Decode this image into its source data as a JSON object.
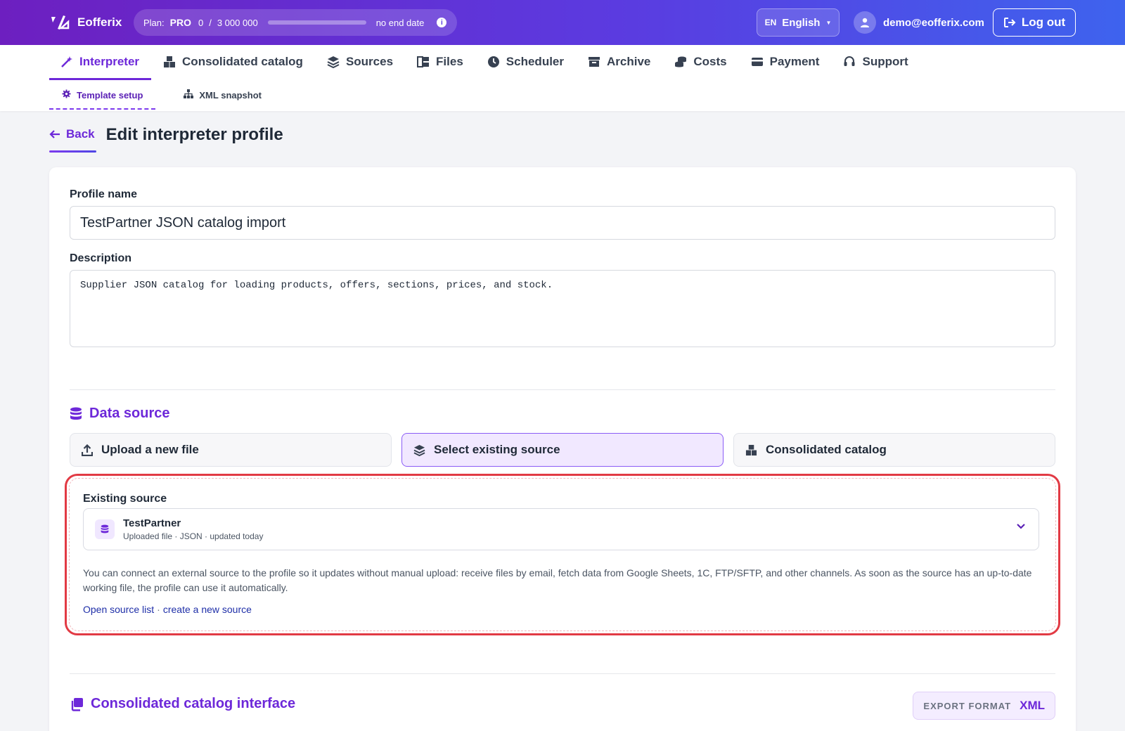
{
  "app": {
    "name": "Eofferix"
  },
  "plan": {
    "label": "Plan:",
    "name": "PRO",
    "used": "0",
    "separator": "/",
    "limit": "3 000 000",
    "usage_fraction": 0,
    "end_date": "no end date",
    "info_icon": "info-icon"
  },
  "language": {
    "code": "EN",
    "name": "English"
  },
  "user": {
    "email": "demo@eofferix.com"
  },
  "logout_label": "Log out",
  "nav": {
    "tabs": [
      {
        "label": "Interpreter",
        "icon": "magic-wand-icon",
        "active": true
      },
      {
        "label": "Consolidated catalog",
        "icon": "boxes-icon"
      },
      {
        "label": "Sources",
        "icon": "layers-icon"
      },
      {
        "label": "Files",
        "icon": "files-icon"
      },
      {
        "label": "Scheduler",
        "icon": "clock-icon"
      },
      {
        "label": "Archive",
        "icon": "archive-icon"
      },
      {
        "label": "Costs",
        "icon": "coins-icon"
      },
      {
        "label": "Payment",
        "icon": "credit-card-icon"
      },
      {
        "label": "Support",
        "icon": "headset-icon"
      }
    ],
    "subtabs": [
      {
        "label": "Template setup",
        "icon": "gear-icon",
        "active": true
      },
      {
        "label": "XML snapshot",
        "icon": "sitemap-icon"
      }
    ]
  },
  "page": {
    "back_label": "Back",
    "title": "Edit interpreter profile"
  },
  "form": {
    "profile_name_label": "Profile name",
    "profile_name_value": "TestPartner JSON catalog import",
    "description_label": "Description",
    "description_value": "Supplier JSON catalog for loading products, offers, sections, prices, and stock."
  },
  "data_source": {
    "title": "Data source",
    "options": [
      {
        "label": "Upload a new file",
        "icon": "upload-icon"
      },
      {
        "label": "Select existing source",
        "icon": "layers-icon",
        "active": true
      },
      {
        "label": "Consolidated catalog",
        "icon": "boxes-icon"
      }
    ],
    "existing_label": "Existing source",
    "selected": {
      "name": "TestPartner",
      "meta": "Uploaded file · JSON · updated today"
    },
    "help_text": "You can connect an external source to the profile so it updates without manual upload: receive files by email, fetch data from Google Sheets, 1C, FTP/SFTP, and other channels. As soon as the source has an up-to-date working file, the profile can use it automatically.",
    "link_open": "Open source list",
    "link_sep": "·",
    "link_create": "create a new source"
  },
  "catalog_interface": {
    "title": "Consolidated catalog interface",
    "export_label": "EXPORT FORMAT",
    "export_value": "XML"
  },
  "colors": {
    "accent": "#6d28d9",
    "highlight": "#e23a44",
    "header_start": "#6d1fc0",
    "header_end": "#3e63ee"
  }
}
